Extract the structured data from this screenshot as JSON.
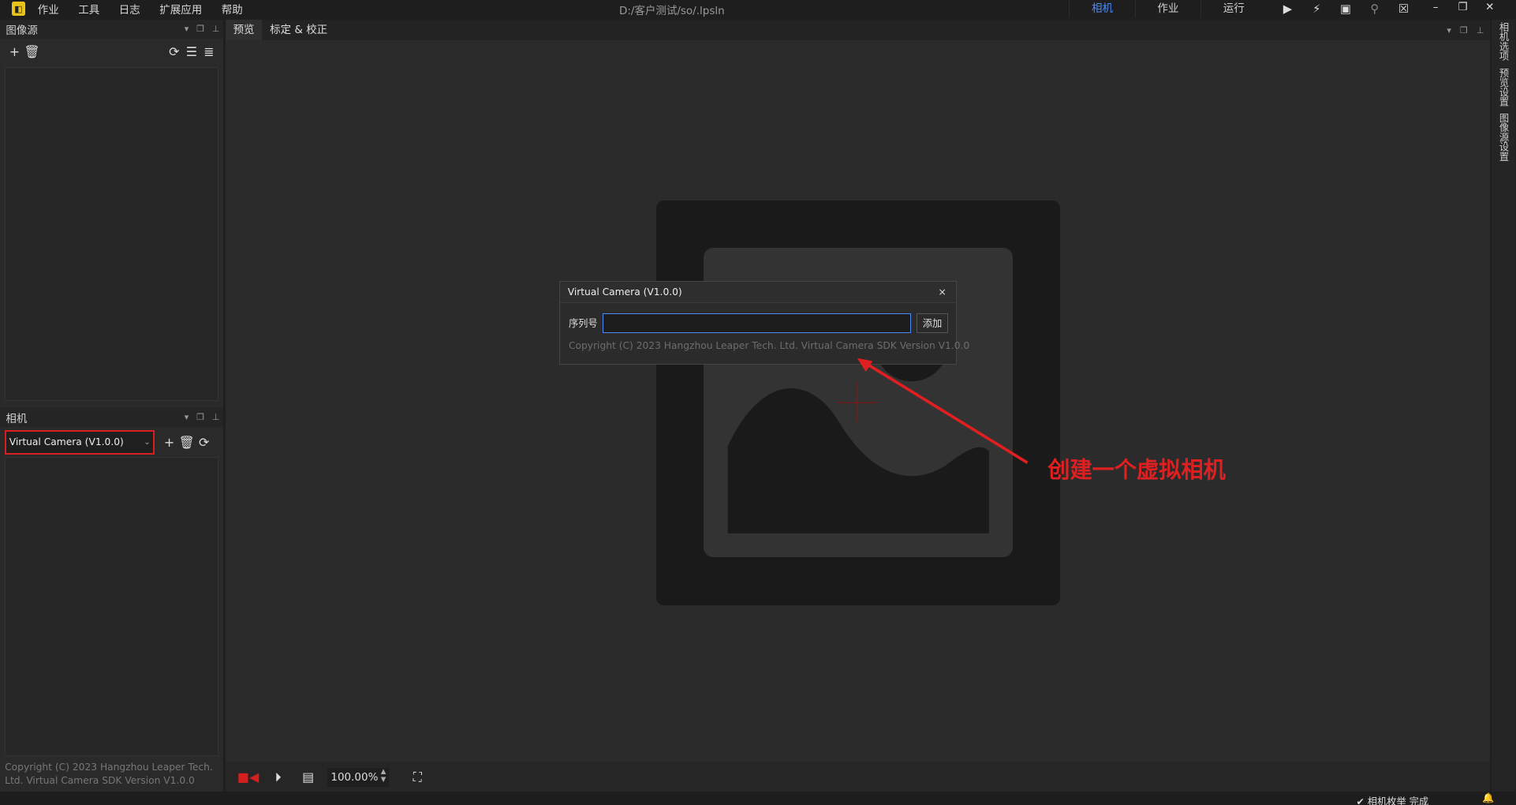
{
  "menubar": {
    "logo": "logo",
    "items": [
      "作业",
      "工具",
      "日志",
      "扩展应用",
      "帮助"
    ],
    "title": "D:/客户测试/so/.lpsln",
    "mode_tabs": [
      "相机",
      "作业",
      "运行"
    ],
    "active_mode": "相机",
    "tool_icons": [
      "play-icon",
      "flash-icon",
      "save-icon",
      "search-icon",
      "user-icon"
    ],
    "window_buttons": [
      "minimize",
      "restore",
      "close"
    ]
  },
  "image_source_panel": {
    "title": "图像源",
    "buttons": [
      "add-icon",
      "delete-icon",
      "refresh-icon",
      "list-icon",
      "tree-icon"
    ]
  },
  "camera_panel": {
    "title": "相机",
    "selected_camera": "Virtual Camera (V1.0.0)",
    "buttons": [
      "add-icon",
      "delete-icon",
      "refresh-icon"
    ],
    "copyright": "Copyright (C) 2023 Hangzhou Leaper Tech. Ltd. Virtual Camera SDK Version V1.0.0"
  },
  "center": {
    "tabs": [
      "预览",
      "标定 & 校正"
    ],
    "active_tab": "预览",
    "zoom": "100.00%"
  },
  "dialog": {
    "title": "Virtual Camera (V1.0.0)",
    "close": "×",
    "label": "序列号",
    "input_value": "",
    "add_button": "添加",
    "copyright": "Copyright (C) 2023 Hangzhou Leaper Tech. Ltd. Virtual Camera SDK Version V1.0.0"
  },
  "annotation": {
    "text": "创建一个虚拟相机",
    "color": "#e02020"
  },
  "right_tabs": [
    "相机选项",
    "预览设置",
    "图像源设置"
  ],
  "status": {
    "text": "相机枚举 完成"
  },
  "colors": {
    "accent": "#4c8bf5",
    "highlight_red": "#d81e1e"
  }
}
